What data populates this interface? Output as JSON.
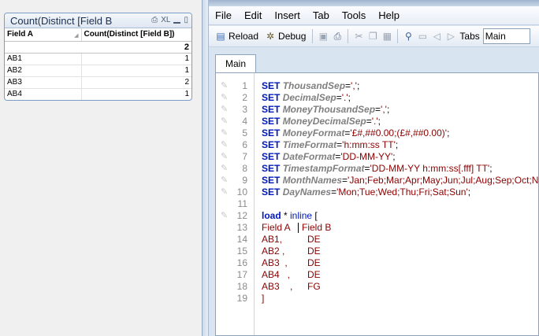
{
  "table": {
    "caption": "Count(Distinct [Field B",
    "caption_icons": [
      "XL"
    ],
    "headers": [
      "Field A",
      "Count(Distinct [Field B])"
    ],
    "total": "2",
    "rows": [
      {
        "a": "AB1",
        "b": "1"
      },
      {
        "a": "AB2",
        "b": "1"
      },
      {
        "a": "AB3",
        "b": "2"
      },
      {
        "a": "AB4",
        "b": "1"
      }
    ]
  },
  "editor": {
    "menu": [
      "File",
      "Edit",
      "Insert",
      "Tab",
      "Tools",
      "Help"
    ],
    "toolbar": {
      "reload_label": "Reload",
      "debug_label": "Debug",
      "tabs_label": "Tabs",
      "tab_select_value": "Main"
    },
    "tab": "Main",
    "colors": {
      "keyword": "#0018b8",
      "variable": "#7f7f7f",
      "string": "#8b0000",
      "line_number": "#8a8a8a"
    },
    "lines": [
      {
        "n": "1",
        "kw": "SET",
        "var": "ThousandSep",
        "eq": "=",
        "val": "','"
      },
      {
        "n": "2",
        "kw": "SET",
        "var": "DecimalSep",
        "eq": "=",
        "val": "'.'"
      },
      {
        "n": "3",
        "kw": "SET",
        "var": "MoneyThousandSep",
        "eq": "=",
        "val": "','"
      },
      {
        "n": "4",
        "kw": "SET",
        "var": "MoneyDecimalSep",
        "eq": "=",
        "val": "'.'"
      },
      {
        "n": "5",
        "kw": "SET",
        "var": "MoneyFormat",
        "eq": "=",
        "val": "'£#,##0.00;(£#,##0.00)'"
      },
      {
        "n": "6",
        "kw": "SET",
        "var": "TimeFormat",
        "eq": "=",
        "val": "'h:mm:ss TT'"
      },
      {
        "n": "7",
        "kw": "SET",
        "var": "DateFormat",
        "eq": "=",
        "val": "'DD-MM-YY'"
      },
      {
        "n": "8",
        "kw": "SET",
        "var": "TimestampFormat",
        "eq": "=",
        "val": "'DD-MM-YY h:mm:ss[.fff] TT'"
      },
      {
        "n": "9",
        "kw": "SET",
        "var": "MonthNames",
        "eq": "=",
        "val": "'Jan;Feb;Mar;Apr;May;Jun;Jul;Aug;Sep;Oct;No"
      },
      {
        "n": "10",
        "kw": "SET",
        "var": "DayNames",
        "eq": "=",
        "val": "'Mon;Tue;Wed;Thu;Fri;Sat;Sun'"
      },
      {
        "n": "11"
      },
      {
        "n": "12",
        "load": "load",
        "star": " * ",
        "inline": "inline",
        "bracket": " ["
      },
      {
        "n": "13",
        "data_a": "Field A",
        "data_b": "Field B",
        "caret": true
      },
      {
        "n": "14",
        "data_a": "AB1,",
        "data_b": "DE"
      },
      {
        "n": "15",
        "data_a": "AB2 ,",
        "data_b": "DE"
      },
      {
        "n": "16",
        "data_a": "AB3  ,",
        "data_b": "DE"
      },
      {
        "n": "17",
        "data_a": "AB4   ,",
        "data_b": "DE"
      },
      {
        "n": "18",
        "data_a": "AB3    ,",
        "data_b": "FG"
      },
      {
        "n": "19",
        "close": "]"
      }
    ]
  }
}
